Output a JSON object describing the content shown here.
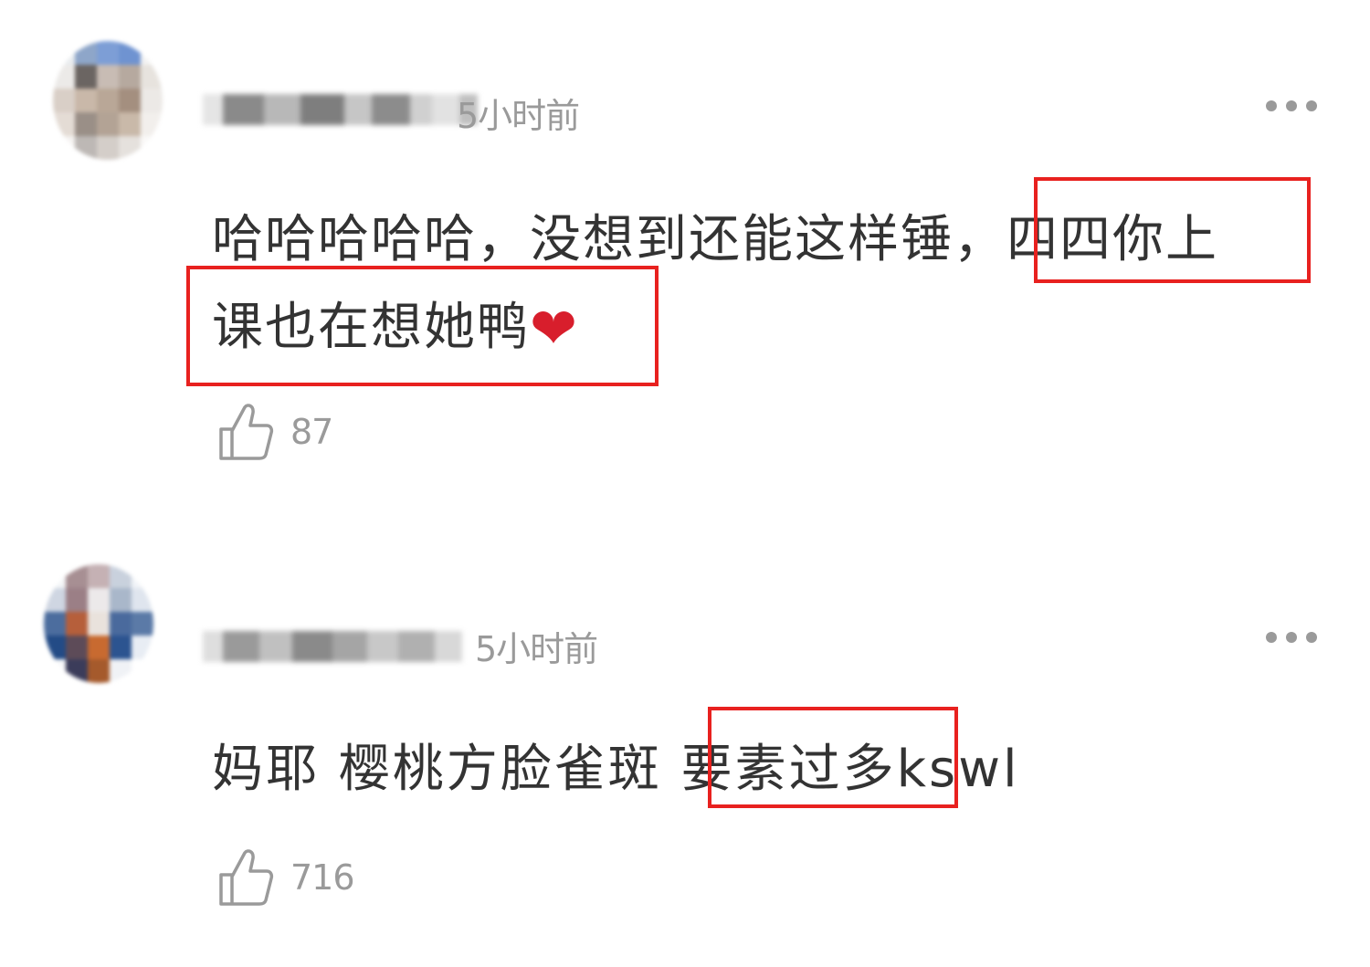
{
  "comments": [
    {
      "time": "5小时前",
      "text_line1": "哈哈哈哈哈，没想到还能这样锤，四四你上",
      "text_line2": "课也在想她鸭",
      "emoji": "❤",
      "likes": "87"
    },
    {
      "time": "5小时前",
      "text_line1": "妈耶  樱桃方脸雀斑 要素过多kswl",
      "likes": "716"
    }
  ],
  "icons": [
    "more-icon",
    "thumbs-up-icon",
    "heart-emoji"
  ],
  "colors": {
    "highlight_border": "#e8211f",
    "meta_gray": "#9a9a9a",
    "text": "#333333"
  }
}
